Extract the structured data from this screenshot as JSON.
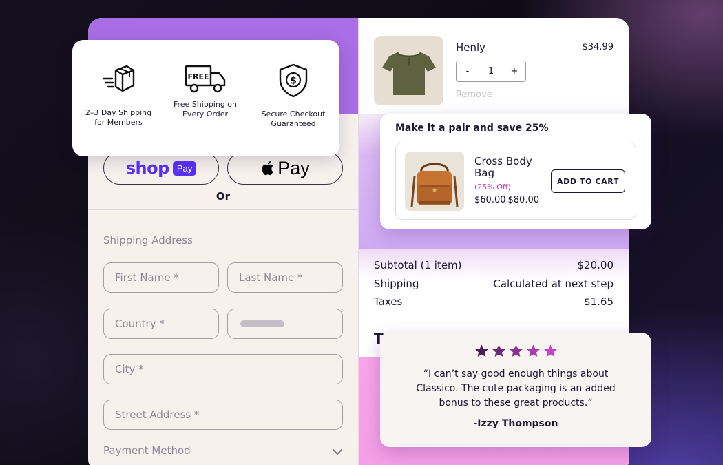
{
  "features": [
    {
      "icon": "fast-shipping-box-icon",
      "label_line1": "2–3 Day Shipping",
      "label_line2": "for Members"
    },
    {
      "icon": "free-shipping-truck-icon",
      "icon_text": "FREE",
      "label_line1": "Free Shipping on",
      "label_line2": "Every Order"
    },
    {
      "icon": "secure-shield-icon",
      "label_line1": "Secure Checkout",
      "label_line2": "Guaranteed"
    }
  ],
  "express_pay": {
    "shop_pay_word": "shop",
    "shop_pay_pill": "Pay",
    "apple_pay_word": "Pay",
    "or_label": "Or"
  },
  "shipping_form": {
    "section_label": "Shipping Address",
    "first_name_placeholder": "First Name *",
    "last_name_placeholder": "Last Name *",
    "country_placeholder": "Country *",
    "city_placeholder": "City *",
    "street_placeholder": "Street Address *"
  },
  "payment": {
    "section_label": "Payment Method"
  },
  "cart_item": {
    "name": "Henly",
    "price": "$34.99",
    "quantity": "1",
    "decrease_label": "-",
    "increase_label": "+",
    "remove_label": "Remove"
  },
  "upsell": {
    "title": "Make it a pair and save 25%",
    "product_name": "Cross Body Bag",
    "discount_label": "(25% Off)",
    "sale_price": "$60.00",
    "original_price": "$80.00",
    "add_button": "ADD TO CART"
  },
  "summary": {
    "subtotal_label": "Subtotal (1 item)",
    "subtotal_value": "$20.00",
    "shipping_label": "Shipping",
    "shipping_value": "Calculated at next step",
    "taxes_label": "Taxes",
    "taxes_value": "$1.65",
    "total_peek": "T"
  },
  "review": {
    "rating": 5,
    "quote": "“I can’t say good enough things about Classico. The cute packaging is an added bonus to these great products.”",
    "author": "-Izzy Thompson"
  },
  "colors": {
    "shop_pay": "#5a31f4",
    "discount": "#d23ab8",
    "left_header": "#a96ee5",
    "star_colors": [
      "#4a1f55",
      "#6d2a78",
      "#8a3395",
      "#a93cb2",
      "#c443cc"
    ]
  }
}
